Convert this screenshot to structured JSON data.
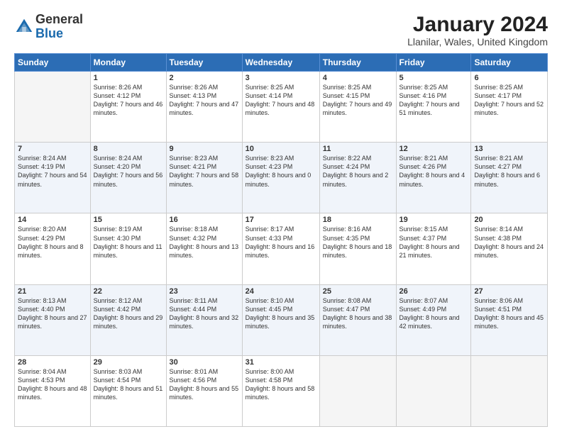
{
  "header": {
    "logo_general": "General",
    "logo_blue": "Blue",
    "title": "January 2024",
    "subtitle": "Llanilar, Wales, United Kingdom"
  },
  "days_of_week": [
    "Sunday",
    "Monday",
    "Tuesday",
    "Wednesday",
    "Thursday",
    "Friday",
    "Saturday"
  ],
  "weeks": [
    [
      {
        "day": "",
        "sunrise": "",
        "sunset": "",
        "daylight": ""
      },
      {
        "day": "1",
        "sunrise": "Sunrise: 8:26 AM",
        "sunset": "Sunset: 4:12 PM",
        "daylight": "Daylight: 7 hours and 46 minutes."
      },
      {
        "day": "2",
        "sunrise": "Sunrise: 8:26 AM",
        "sunset": "Sunset: 4:13 PM",
        "daylight": "Daylight: 7 hours and 47 minutes."
      },
      {
        "day": "3",
        "sunrise": "Sunrise: 8:25 AM",
        "sunset": "Sunset: 4:14 PM",
        "daylight": "Daylight: 7 hours and 48 minutes."
      },
      {
        "day": "4",
        "sunrise": "Sunrise: 8:25 AM",
        "sunset": "Sunset: 4:15 PM",
        "daylight": "Daylight: 7 hours and 49 minutes."
      },
      {
        "day": "5",
        "sunrise": "Sunrise: 8:25 AM",
        "sunset": "Sunset: 4:16 PM",
        "daylight": "Daylight: 7 hours and 51 minutes."
      },
      {
        "day": "6",
        "sunrise": "Sunrise: 8:25 AM",
        "sunset": "Sunset: 4:17 PM",
        "daylight": "Daylight: 7 hours and 52 minutes."
      }
    ],
    [
      {
        "day": "7",
        "sunrise": "Sunrise: 8:24 AM",
        "sunset": "Sunset: 4:19 PM",
        "daylight": "Daylight: 7 hours and 54 minutes."
      },
      {
        "day": "8",
        "sunrise": "Sunrise: 8:24 AM",
        "sunset": "Sunset: 4:20 PM",
        "daylight": "Daylight: 7 hours and 56 minutes."
      },
      {
        "day": "9",
        "sunrise": "Sunrise: 8:23 AM",
        "sunset": "Sunset: 4:21 PM",
        "daylight": "Daylight: 7 hours and 58 minutes."
      },
      {
        "day": "10",
        "sunrise": "Sunrise: 8:23 AM",
        "sunset": "Sunset: 4:23 PM",
        "daylight": "Daylight: 8 hours and 0 minutes."
      },
      {
        "day": "11",
        "sunrise": "Sunrise: 8:22 AM",
        "sunset": "Sunset: 4:24 PM",
        "daylight": "Daylight: 8 hours and 2 minutes."
      },
      {
        "day": "12",
        "sunrise": "Sunrise: 8:21 AM",
        "sunset": "Sunset: 4:26 PM",
        "daylight": "Daylight: 8 hours and 4 minutes."
      },
      {
        "day": "13",
        "sunrise": "Sunrise: 8:21 AM",
        "sunset": "Sunset: 4:27 PM",
        "daylight": "Daylight: 8 hours and 6 minutes."
      }
    ],
    [
      {
        "day": "14",
        "sunrise": "Sunrise: 8:20 AM",
        "sunset": "Sunset: 4:29 PM",
        "daylight": "Daylight: 8 hours and 8 minutes."
      },
      {
        "day": "15",
        "sunrise": "Sunrise: 8:19 AM",
        "sunset": "Sunset: 4:30 PM",
        "daylight": "Daylight: 8 hours and 11 minutes."
      },
      {
        "day": "16",
        "sunrise": "Sunrise: 8:18 AM",
        "sunset": "Sunset: 4:32 PM",
        "daylight": "Daylight: 8 hours and 13 minutes."
      },
      {
        "day": "17",
        "sunrise": "Sunrise: 8:17 AM",
        "sunset": "Sunset: 4:33 PM",
        "daylight": "Daylight: 8 hours and 16 minutes."
      },
      {
        "day": "18",
        "sunrise": "Sunrise: 8:16 AM",
        "sunset": "Sunset: 4:35 PM",
        "daylight": "Daylight: 8 hours and 18 minutes."
      },
      {
        "day": "19",
        "sunrise": "Sunrise: 8:15 AM",
        "sunset": "Sunset: 4:37 PM",
        "daylight": "Daylight: 8 hours and 21 minutes."
      },
      {
        "day": "20",
        "sunrise": "Sunrise: 8:14 AM",
        "sunset": "Sunset: 4:38 PM",
        "daylight": "Daylight: 8 hours and 24 minutes."
      }
    ],
    [
      {
        "day": "21",
        "sunrise": "Sunrise: 8:13 AM",
        "sunset": "Sunset: 4:40 PM",
        "daylight": "Daylight: 8 hours and 27 minutes."
      },
      {
        "day": "22",
        "sunrise": "Sunrise: 8:12 AM",
        "sunset": "Sunset: 4:42 PM",
        "daylight": "Daylight: 8 hours and 29 minutes."
      },
      {
        "day": "23",
        "sunrise": "Sunrise: 8:11 AM",
        "sunset": "Sunset: 4:44 PM",
        "daylight": "Daylight: 8 hours and 32 minutes."
      },
      {
        "day": "24",
        "sunrise": "Sunrise: 8:10 AM",
        "sunset": "Sunset: 4:45 PM",
        "daylight": "Daylight: 8 hours and 35 minutes."
      },
      {
        "day": "25",
        "sunrise": "Sunrise: 8:08 AM",
        "sunset": "Sunset: 4:47 PM",
        "daylight": "Daylight: 8 hours and 38 minutes."
      },
      {
        "day": "26",
        "sunrise": "Sunrise: 8:07 AM",
        "sunset": "Sunset: 4:49 PM",
        "daylight": "Daylight: 8 hours and 42 minutes."
      },
      {
        "day": "27",
        "sunrise": "Sunrise: 8:06 AM",
        "sunset": "Sunset: 4:51 PM",
        "daylight": "Daylight: 8 hours and 45 minutes."
      }
    ],
    [
      {
        "day": "28",
        "sunrise": "Sunrise: 8:04 AM",
        "sunset": "Sunset: 4:53 PM",
        "daylight": "Daylight: 8 hours and 48 minutes."
      },
      {
        "day": "29",
        "sunrise": "Sunrise: 8:03 AM",
        "sunset": "Sunset: 4:54 PM",
        "daylight": "Daylight: 8 hours and 51 minutes."
      },
      {
        "day": "30",
        "sunrise": "Sunrise: 8:01 AM",
        "sunset": "Sunset: 4:56 PM",
        "daylight": "Daylight: 8 hours and 55 minutes."
      },
      {
        "day": "31",
        "sunrise": "Sunrise: 8:00 AM",
        "sunset": "Sunset: 4:58 PM",
        "daylight": "Daylight: 8 hours and 58 minutes."
      },
      {
        "day": "",
        "sunrise": "",
        "sunset": "",
        "daylight": ""
      },
      {
        "day": "",
        "sunrise": "",
        "sunset": "",
        "daylight": ""
      },
      {
        "day": "",
        "sunrise": "",
        "sunset": "",
        "daylight": ""
      }
    ]
  ]
}
